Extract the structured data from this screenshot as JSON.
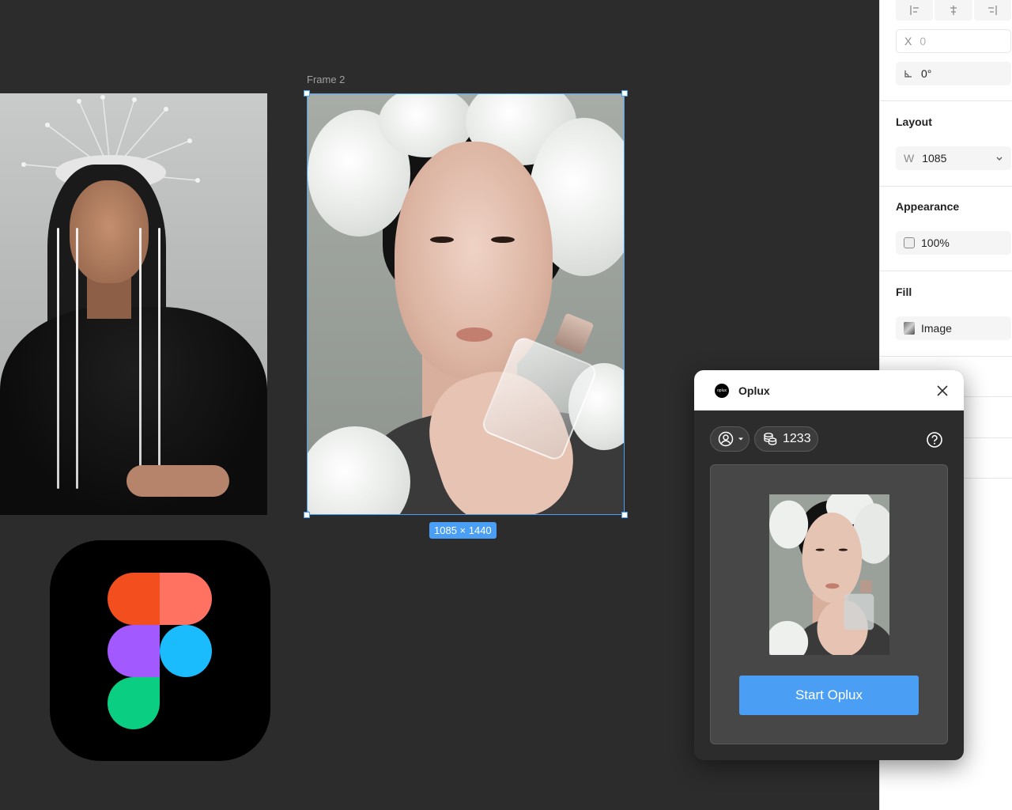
{
  "canvas": {
    "frame_label": "Frame 2",
    "frame_size_badge": "1085 × 1440"
  },
  "properties_panel": {
    "align_icons": [
      "align-left-icon",
      "align-center-horizontal-icon",
      "align-right-icon"
    ],
    "x_field": {
      "prefix": "X",
      "value": "0"
    },
    "rotation_field": {
      "icon": "angle-icon",
      "value": "0°"
    },
    "layout": {
      "title": "Layout",
      "width_prefix": "W",
      "width_value": "1085"
    },
    "appearance": {
      "title": "Appearance",
      "opacity_value": "100%"
    },
    "fill": {
      "title": "Fill",
      "fill_value": "Image"
    }
  },
  "plugin": {
    "title": "Oplux",
    "logo_text": "oplux",
    "credits": "1233",
    "start_button_label": "Start Oplux"
  },
  "colors": {
    "canvas_bg": "#2c2c2c",
    "selection_blue": "#4a9ff5",
    "panel_bg": "#ffffff",
    "figma_red": "#f24e1e",
    "figma_orange": "#ff7262",
    "figma_purple": "#a259ff",
    "figma_blue": "#1abcfe",
    "figma_green": "#0acf83"
  }
}
